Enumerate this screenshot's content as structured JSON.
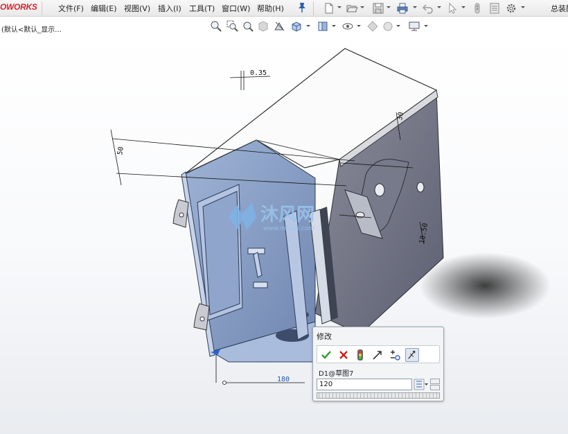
{
  "app": {
    "brand": "OWORKS",
    "right_title": "总装配"
  },
  "menu": {
    "items": [
      "文件(F)",
      "编辑(E)",
      "视图(V)",
      "插入(I)",
      "工具(T)",
      "窗口(W)",
      "帮助(H)"
    ]
  },
  "toolbar": {
    "icons": [
      "new-document-icon",
      "open-folder-icon",
      "save-icon",
      "print-icon",
      "undo-icon",
      "select-cursor-icon",
      "rebuild-icon",
      "file-properties-icon",
      "options-gear-icon"
    ]
  },
  "config_label": "(默认<默认_显示...",
  "view_toolbar": {
    "icons": [
      "zoom-to-fit-icon",
      "zoom-to-area-icon",
      "previous-view-icon",
      "section-view-icon",
      "dynamic-annotation-icon",
      "view-orientation-icon",
      "display-style-icon",
      "hide-show-items-icon",
      "edit-appearance-icon",
      "apply-scene-icon",
      "view-settings-icon"
    ]
  },
  "dimensions": {
    "d1": "0.35",
    "d2": "50",
    "d3": "30",
    "d4": "18.50",
    "d5": "180"
  },
  "watermark": {
    "brand": "沐风网",
    "url": "www.mfcad.com"
  },
  "modify_dialog": {
    "title": "修改",
    "dimension_name": "D1@草图7",
    "value": "120",
    "buttons": [
      "ok-check-icon",
      "cancel-x-icon",
      "rebuild-traffic-light-icon",
      "reverse-direction-icon",
      "reset-spin-increment-icon",
      "mark-for-drawing-icon"
    ],
    "colors": {
      "ok": "#2e9b2e",
      "cancel": "#c8201e"
    }
  }
}
